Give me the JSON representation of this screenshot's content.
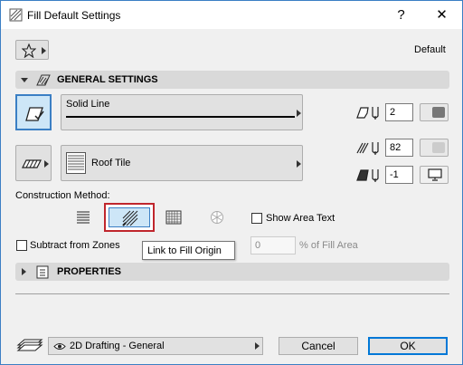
{
  "window": {
    "title": "Fill Default Settings",
    "help_label": "?",
    "close_label": "✕"
  },
  "header": {
    "favorites_icon": "star-icon",
    "default_label": "Default"
  },
  "general": {
    "title": "GENERAL SETTINGS",
    "line_type": "Solid Line",
    "fill_type": "Roof Tile",
    "pen_contour": "2",
    "pen_fill": "82",
    "pen_bg": "-1",
    "construction_label": "Construction Method:",
    "show_area_label": "Show Area Text",
    "subtract_zones_label": "Subtract from Zones",
    "tooltip": "Link to Fill Origin",
    "fill_area_value": "0",
    "fill_area_label": "% of Fill Area"
  },
  "properties": {
    "title": "PROPERTIES"
  },
  "footer": {
    "layer": "2D Drafting - General",
    "cancel_label": "Cancel",
    "ok_label": "OK"
  },
  "colors": {
    "accent": "#3b7fc4",
    "selected_blue": "#cde6f7",
    "highlight_red": "#c0262d",
    "pen_gray": "#777777"
  }
}
